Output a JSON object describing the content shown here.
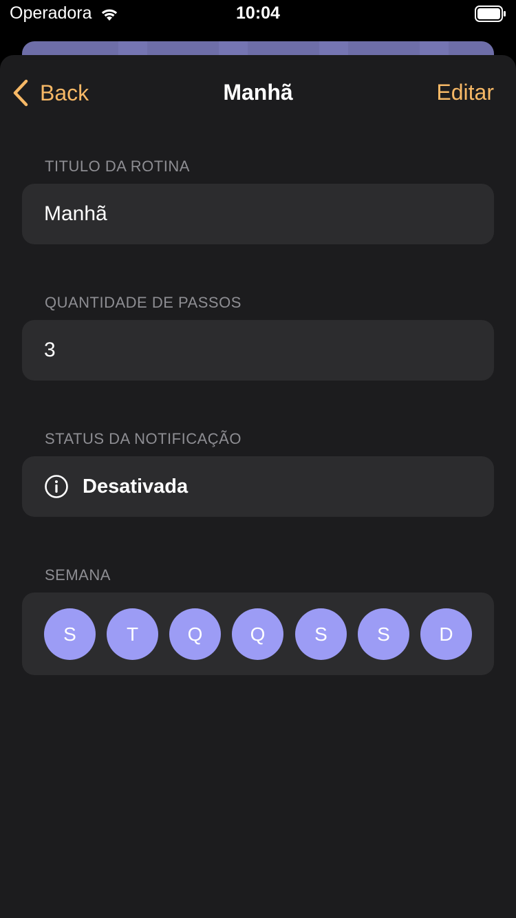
{
  "status_bar": {
    "carrier": "Operadora",
    "time": "10:04",
    "wifi_icon": "wifi-icon",
    "battery_icon": "battery-icon"
  },
  "nav": {
    "back_label": "Back",
    "title": "Manhã",
    "edit_label": "Editar",
    "accent_color": "#f6b866"
  },
  "sections": {
    "title": {
      "header": "TITULO DA ROTINA",
      "value": "Manhã"
    },
    "steps": {
      "header": "QUANTIDADE DE PASSOS",
      "value": "3"
    },
    "notification": {
      "header": "STATUS DA NOTIFICAÇÃO",
      "icon": "info-icon",
      "value": "Desativada"
    },
    "week": {
      "header": "SEMANA",
      "days": [
        "S",
        "T",
        "Q",
        "Q",
        "S",
        "S",
        "D"
      ],
      "day_color": "#9c9cf5"
    }
  }
}
